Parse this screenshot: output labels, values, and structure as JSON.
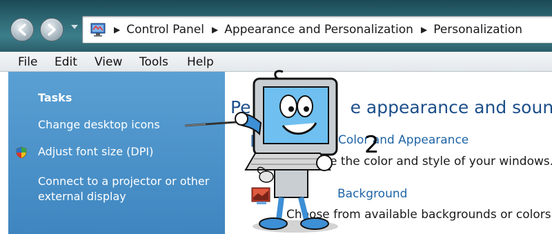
{
  "address_bar": {
    "breadcrumbs": [
      "Control Panel",
      "Appearance and Personalization",
      "Personalization"
    ]
  },
  "menu": {
    "items": [
      "File",
      "Edit",
      "View",
      "Tools",
      "Help"
    ]
  },
  "tasks": {
    "heading": "Tasks",
    "links": [
      {
        "label": "Change desktop icons"
      },
      {
        "label": "Adjust font size (DPI)",
        "icon": "shield-icon"
      },
      {
        "label_line1": "Connect to a projector or other",
        "label_line2": "external display"
      }
    ]
  },
  "main": {
    "title_visible_start": "Pe",
    "title_visible_end": "e appearance and sounds",
    "color_appearance": {
      "link": "Color and Appearance",
      "desc_visible": "e the color and style of your windows."
    },
    "desktop_background": {
      "link_visible": "Background",
      "desc_visible": "Choose from available backgrounds or colors o"
    },
    "step_number": "2"
  },
  "colors": {
    "taskpane": "#4a91c9",
    "titlebar": "#2f6a76",
    "link": "#1e63a6"
  }
}
